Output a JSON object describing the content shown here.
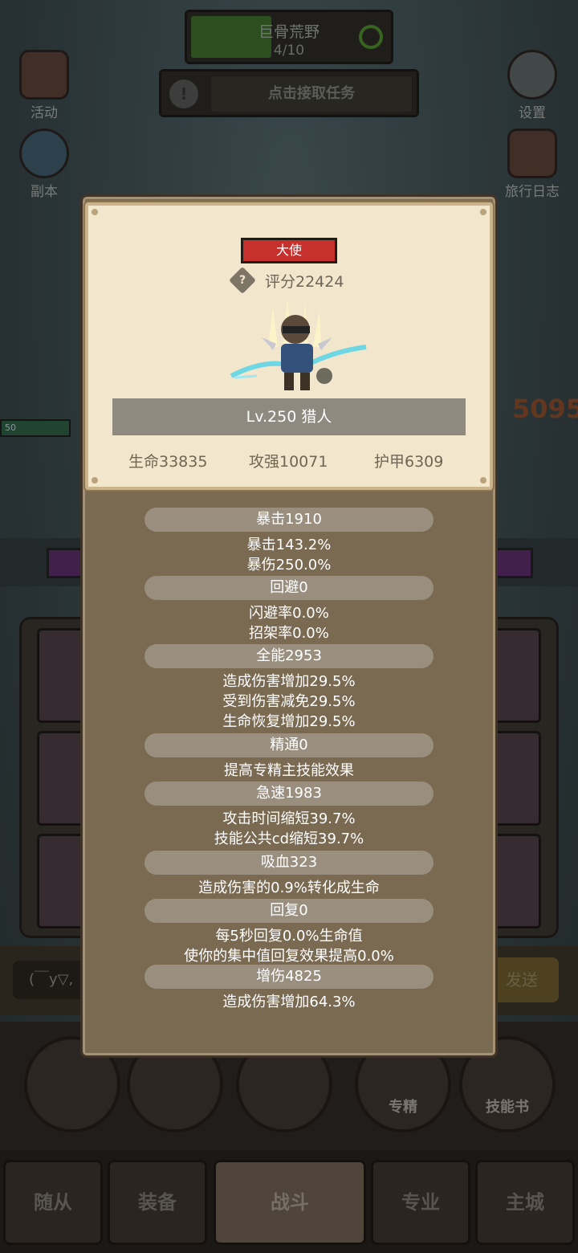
{
  "background": {
    "map_name": "巨骨荒野",
    "map_progress": "4/10",
    "task_prompt": "点击接取任务",
    "side_left": [
      {
        "label": "活动",
        "icon": "event-icon"
      },
      {
        "label": "副本",
        "icon": "dungeon-icon"
      }
    ],
    "side_right": [
      {
        "label": "设置",
        "icon": "gear-icon"
      },
      {
        "label": "旅行日志",
        "icon": "journal-icon"
      }
    ],
    "damage_number": "5095",
    "enemy_level": "50",
    "chat_placeholder": "(￣y▽,",
    "send_label": "发送",
    "skill_buttons": [
      {
        "label": "",
        "icon": "potion-icon"
      },
      {
        "label": "",
        "icon": "bread-icon"
      },
      {
        "label": "",
        "icon": "chest-icon"
      },
      {
        "label": "专精",
        "icon": "specialization-icon"
      },
      {
        "label": "技能书",
        "icon": "skillbook-icon"
      }
    ],
    "nav_tabs": [
      {
        "label": "随从",
        "active": false
      },
      {
        "label": "装备",
        "active": false
      },
      {
        "label": "战斗",
        "active": true
      },
      {
        "label": "专业",
        "active": false
      },
      {
        "label": "主城",
        "active": false
      }
    ]
  },
  "character": {
    "rank": "大使",
    "score": "评分22424",
    "level_class": "Lv.250 猎人",
    "hp": "生命33835",
    "attack": "攻强10071",
    "armor": "护甲6309"
  },
  "stats": [
    {
      "head": "暴击1910",
      "lines": [
        "暴击143.2%",
        "暴伤250.0%"
      ]
    },
    {
      "head": "回避0",
      "lines": [
        "闪避率0.0%",
        "招架率0.0%"
      ]
    },
    {
      "head": "全能2953",
      "lines": [
        "造成伤害增加29.5%",
        "受到伤害减免29.5%",
        "生命恢复增加29.5%"
      ]
    },
    {
      "head": "精通0",
      "lines": [
        "提高专精主技能效果"
      ]
    },
    {
      "head": "急速1983",
      "lines": [
        "攻击时间缩短39.7%",
        "技能公共cd缩短39.7%"
      ]
    },
    {
      "head": "吸血323",
      "lines": [
        "造成伤害的0.9%转化成生命"
      ]
    },
    {
      "head": "回复0",
      "lines": [
        "每5秒回复0.0%生命值",
        "使你的集中值回复效果提高0.0%"
      ]
    },
    {
      "head": "增伤4825",
      "lines": [
        "造成伤害增加64.3%"
      ]
    }
  ],
  "colors": {
    "rank_badge": "#c6312e",
    "card_bg": "#f2e6cc",
    "popup_bg": "#7a6a52",
    "stat_head_bg": "#9a8f7f"
  }
}
